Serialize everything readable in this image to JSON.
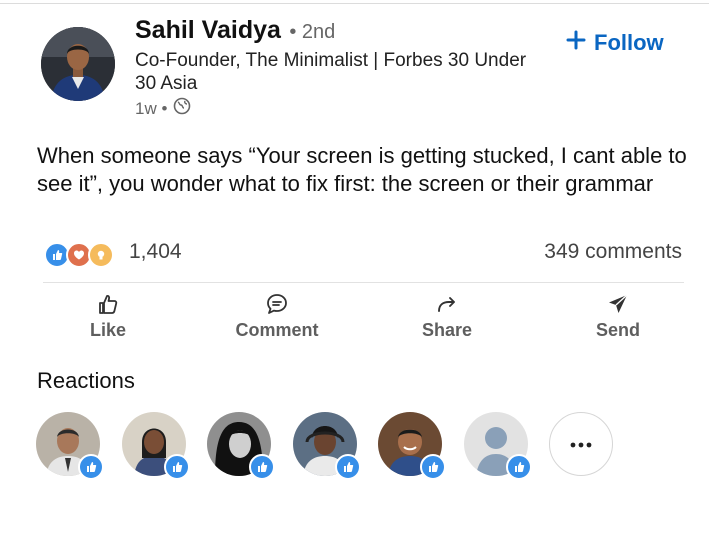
{
  "author": {
    "name": "Sahil Vaidya",
    "degree": "• 2nd",
    "headline": "Co-Founder, The Minimalist | Forbes 30 Under 30 Asia",
    "time": "1w •",
    "visibility_icon": "globe-icon"
  },
  "follow": {
    "label": "Follow",
    "icon": "plus-icon"
  },
  "post": {
    "text": "When someone says “Your screen is getting stucked, I cant able to see it”, you wonder what to fix first: the screen or their grammar"
  },
  "social": {
    "reaction_icons": [
      "like-icon",
      "love-icon",
      "insightful-icon"
    ],
    "reaction_count": "1,404",
    "comments": "349 comments"
  },
  "actions": [
    {
      "label": "Like",
      "icon": "thumbs-up-icon"
    },
    {
      "label": "Comment",
      "icon": "comment-icon"
    },
    {
      "label": "Share",
      "icon": "share-icon"
    },
    {
      "label": "Send",
      "icon": "send-icon"
    }
  ],
  "reactions": {
    "title": "Reactions",
    "more_icon": "more-icon"
  },
  "colors": {
    "accent": "#0a66c2",
    "like_badge": "#378fe9",
    "muted_text": "#666666"
  }
}
